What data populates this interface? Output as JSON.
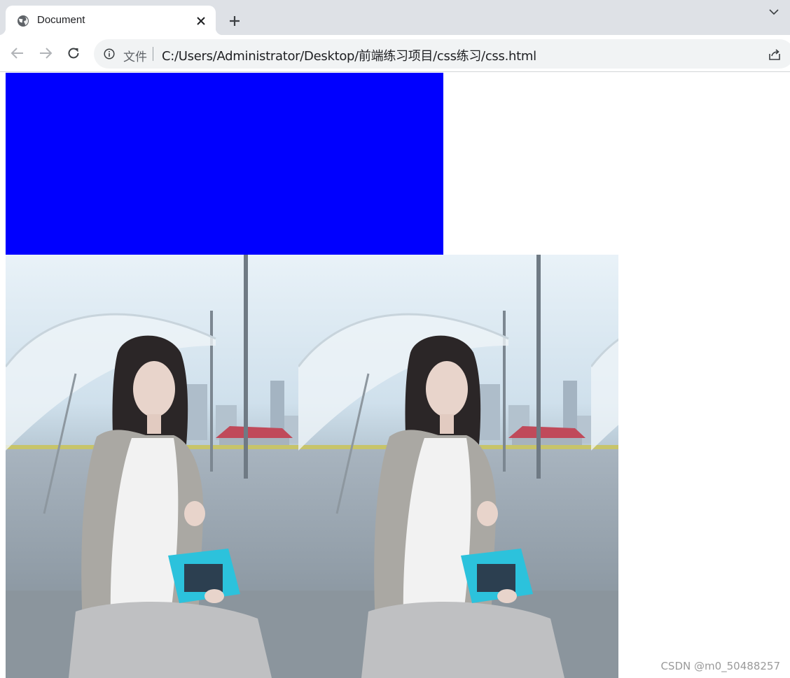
{
  "browser": {
    "tab": {
      "title": "Document",
      "favicon": "globe-icon",
      "close_icon": "close-icon"
    },
    "new_tab_icon": "plus-icon",
    "tab_search_icon": "chevron-down-icon",
    "toolbar": {
      "back_icon": "back-arrow-icon",
      "forward_icon": "forward-arrow-icon",
      "reload_icon": "reload-icon",
      "site_info_icon": "info-icon",
      "scheme_label": "文件",
      "url": "C:/Users/Administrator/Desktop/前端练习项目/css练习/css.html",
      "share_icon": "share-icon"
    }
  },
  "page": {
    "box_color": "#0000ff",
    "background_image": "woman-with-umbrella-photo",
    "watermark": "CSDN @m0_50488257"
  }
}
